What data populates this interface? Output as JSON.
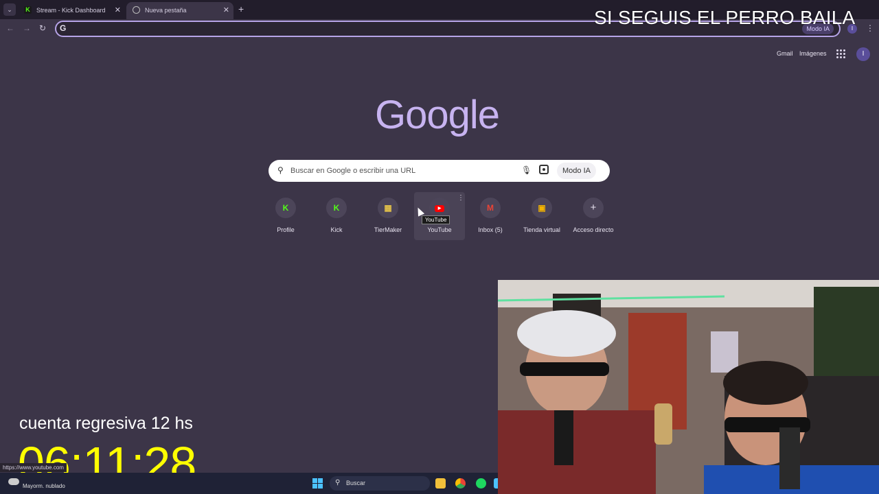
{
  "tabs": [
    {
      "title": "Stream - Kick Dashboard",
      "favicon": "kick-icon"
    },
    {
      "title": "Nueva pestaña",
      "favicon": "chrome-icon"
    }
  ],
  "omnibox": {
    "value": "",
    "ai_button": "Modo IA"
  },
  "overlay": {
    "title": "SI SEGUIS EL PERRO BAILA",
    "countdown_label": "cuenta regresiva 12 hs",
    "countdown_time": "06:11:28"
  },
  "header_links": {
    "gmail": "Gmail",
    "images": "Imágenes",
    "profile_initial": "I"
  },
  "logo": "Google",
  "search": {
    "placeholder": "Buscar en Google o escribir una URL",
    "ai_mode_label": "Modo IA"
  },
  "shortcuts": [
    {
      "label": "Profile",
      "icon": "K"
    },
    {
      "label": "Kick",
      "icon": "K"
    },
    {
      "label": "TierMaker",
      "icon": "▦"
    },
    {
      "label": "YouTube",
      "icon": "▶"
    },
    {
      "label": "Inbox (5)",
      "icon": "M"
    },
    {
      "label": "Tienda virtual",
      "icon": "▣"
    },
    {
      "label": "Acceso directo",
      "icon": "+"
    }
  ],
  "tooltip": "YouTube",
  "status_url": "https://www.youtube.com",
  "taskbar": {
    "weather": "Mayorm. nublado",
    "search_label": "Buscar"
  },
  "colors": {
    "page_bg": "#3c3548",
    "logo": "#c7b3f0",
    "countdown": "#ffff00",
    "kick_green": "#53fc18"
  }
}
